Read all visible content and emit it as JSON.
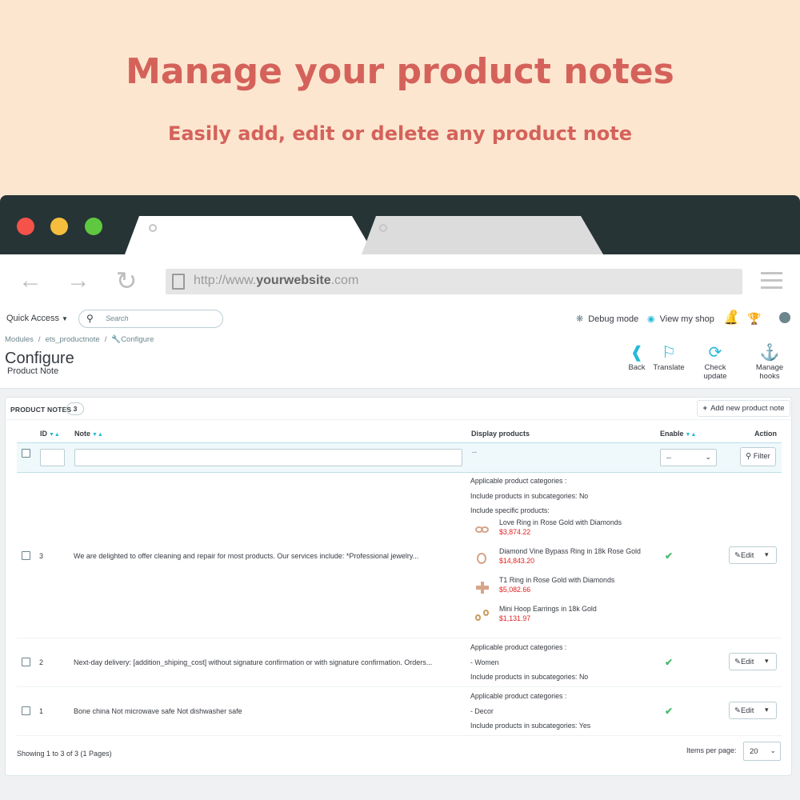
{
  "promo": {
    "title": "Manage your product notes",
    "subtitle": "Easily add, edit or delete any product note"
  },
  "browser": {
    "url_prefix": "http://www.",
    "url_domain": "yourwebsite",
    "url_suffix": ".com",
    "colors": {
      "titlebar": "#263436",
      "close": "#f5524a",
      "minimize": "#f5be3d",
      "maximize": "#5ec940"
    }
  },
  "admin_header": {
    "quick_access": "Quick Access",
    "search_placeholder": "Search",
    "debug_mode": "Debug mode",
    "view_shop": "View my shop",
    "notification_count": "1"
  },
  "breadcrumb": {
    "items": [
      "Modules",
      "ets_productnote",
      "Configure"
    ],
    "separator": "/"
  },
  "page": {
    "title": "Configure",
    "subtitle": "Product Note"
  },
  "toolbar_actions": {
    "back": "Back",
    "translate": "Translate",
    "check_update": "Check update",
    "manage_hooks": "Manage hooks"
  },
  "panel": {
    "title": "PRODUCT NOTES",
    "count": "3",
    "add_button": "Add new product note",
    "columns": {
      "id": "ID",
      "note": "Note",
      "display_products": "Display products",
      "enable": "Enable",
      "action": "Action"
    },
    "filter": {
      "display_placeholder": "--",
      "enable_value": "--",
      "filter_button": "Filter"
    },
    "rows": [
      {
        "id": "3",
        "note": "We are delighted to offer cleaning and repair for most products. Our services include: *Professional jewelry...",
        "display": {
          "line1": "Applicable product categories :",
          "line2": "Include products in subcategories: No",
          "line3": "Include specific products:",
          "products": [
            {
              "name": "Love Ring in Rose Gold with Diamonds",
              "price": "$3,874.22"
            },
            {
              "name": "Diamond Vine Bypass Ring in 18k Rose Gold",
              "price": "$14,843.20"
            },
            {
              "name": "T1 Ring in Rose Gold with Diamonds",
              "price": "$5,082.66"
            },
            {
              "name": "Mini Hoop Earrings in 18k Gold",
              "price": "$1,131.97"
            }
          ]
        },
        "enabled": true,
        "edit_label": "Edit"
      },
      {
        "id": "2",
        "note": "Next-day delivery: [addition_shiping_cost] without signature confirmation or with signature confirmation. Orders...",
        "display": {
          "line1": "Applicable product categories :",
          "line2": "- Women",
          "line3": "Include products in subcategories: No"
        },
        "enabled": true,
        "edit_label": "Edit"
      },
      {
        "id": "1",
        "note": "Bone china Not microwave safe Not dishwasher safe",
        "display": {
          "line1": "Applicable product categories :",
          "line2": "- Decor",
          "line3": "Include products in subcategories: Yes"
        },
        "enabled": true,
        "edit_label": "Edit"
      }
    ],
    "footer": {
      "showing": "Showing 1 to 3 of 3 (1 Pages)",
      "items_per_page_label": "Items per page:",
      "items_per_page_value": "20"
    }
  }
}
